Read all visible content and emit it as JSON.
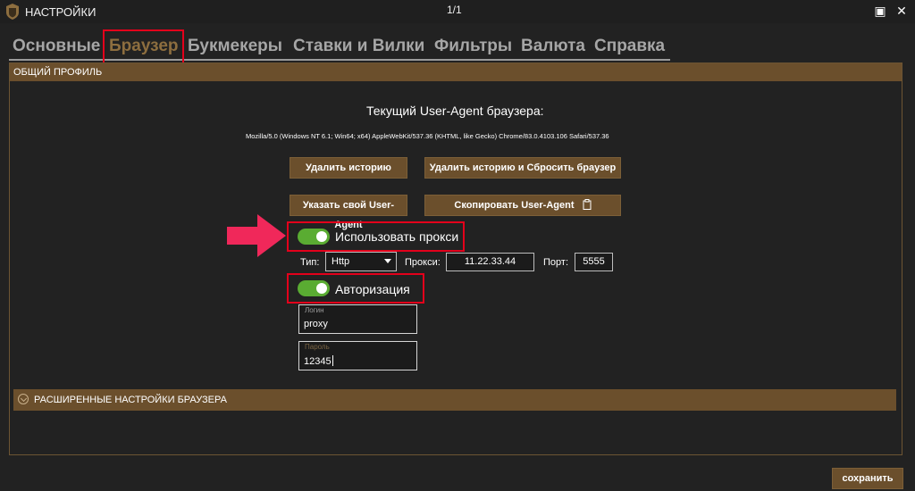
{
  "window": {
    "title": "НАСТРОЙКИ",
    "page_counter": "1/1",
    "maximize_glyph": "▣",
    "close_glyph": "✕"
  },
  "tabs": [
    {
      "label": "Основные",
      "active": false
    },
    {
      "label": "Браузер",
      "active": true
    },
    {
      "label": "Букмекеры",
      "active": false
    },
    {
      "label": "Ставки и Вилки",
      "active": false
    },
    {
      "label": "Фильтры",
      "active": false
    },
    {
      "label": "Валюта",
      "active": false
    },
    {
      "label": "Справка",
      "active": false
    }
  ],
  "profile": {
    "header": "ОБЩИЙ ПРОФИЛЬ",
    "ua_title": "Текущий User-Agent браузера:",
    "ua_string": "Mozilla/5.0 (Windows NT 6.1; Win64; x64) AppleWebKit/537.36 (KHTML, like Gecko) Chrome/83.0.4103.106 Safari/537.36",
    "buttons": {
      "delete_history": "Удалить историю",
      "delete_and_reset": "Удалить историю и Сбросить браузер",
      "set_user_agent": "Указать свой User-Agent",
      "copy_user_agent": "Скопировать User-Agent"
    }
  },
  "proxy": {
    "toggle_label": "Использовать прокси",
    "enabled": true,
    "type_label": "Тип:",
    "type_value": "Http",
    "proxy_label": "Прокси:",
    "proxy_value": "11.22.33.44",
    "port_label": "Порт:",
    "port_value": "5555"
  },
  "auth": {
    "toggle_label": "Авторизация",
    "enabled": true,
    "login_label": "Логин",
    "login_value": "proxy",
    "password_label": "Пароль",
    "password_value": "12345"
  },
  "advanced": {
    "label": "РАСШИРЕННЫЕ НАСТРОЙКИ БРАУЗЕРА"
  },
  "footer": {
    "save_label": "сохранить"
  },
  "colors": {
    "accent_brown": "#6b4f2c",
    "toggle_green": "#5aac32",
    "highlight_red": "#e3001b",
    "arrow_pink": "#f0285a"
  },
  "icons": {
    "app": "app-logo-icon",
    "copy": "clipboard-icon",
    "expand": "chevron-circle-down-icon",
    "pointer": "arrow-right-icon"
  }
}
